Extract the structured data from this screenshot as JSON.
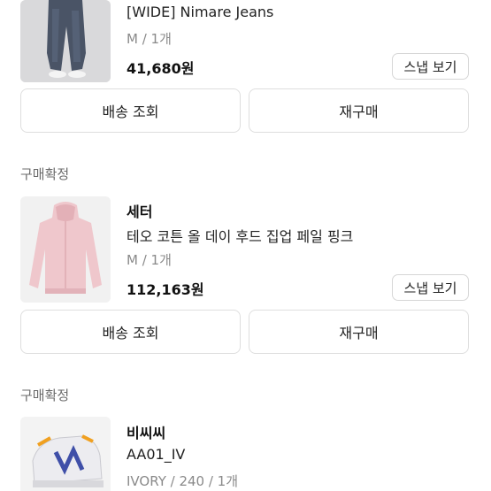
{
  "orders": [
    {
      "product_name": "[WIDE] Nimare Jeans",
      "option": "M / 1개",
      "price": "41,680원",
      "snap_label": "스냅 보기",
      "delivery_label": "배송 조회",
      "rebuy_label": "재구매"
    },
    {
      "status": "구매확정",
      "brand": "세터",
      "product_name": "테오 코튼 올 데이 후드 집업 페일 핑크",
      "option": "M / 1개",
      "price": "112,163원",
      "snap_label": "스냅 보기",
      "delivery_label": "배송 조회",
      "rebuy_label": "재구매"
    },
    {
      "status": "구매확정",
      "brand": "비씨씨",
      "product_name": "AA01_IV",
      "option": "IVORY / 240 / 1개"
    }
  ]
}
